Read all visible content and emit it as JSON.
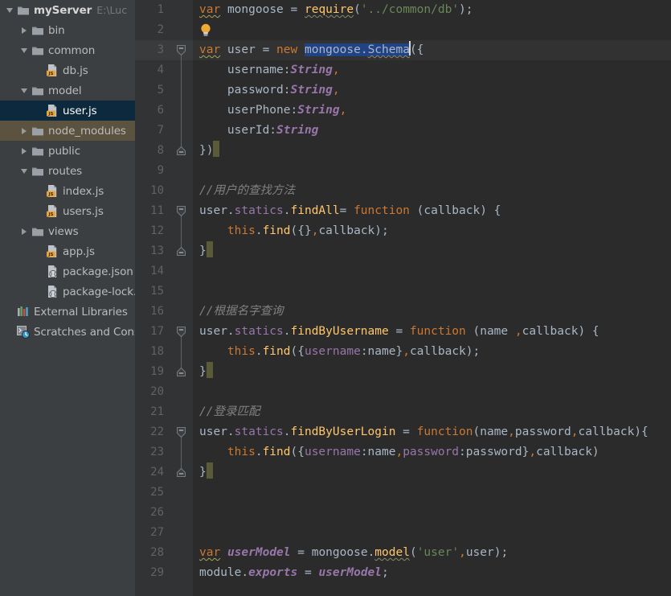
{
  "window": {
    "theme": "darcula",
    "accent_selection": "#214283",
    "sidebar_bg": "#3c3f41",
    "editor_bg": "#2b2b2b",
    "gutter_bg": "#313335",
    "current_line_bg": "#323232",
    "selected_row_bg": "#0d293e",
    "excluded_row_bg": "#5b5340"
  },
  "sidebar": {
    "items": [
      {
        "label": "myServer",
        "hint": "E:\\Luc",
        "indent": 0,
        "twisty": "expanded",
        "icon": "folder-icon",
        "bold": true,
        "state": "normal"
      },
      {
        "label": "bin",
        "hint": "",
        "indent": 1,
        "twisty": "collapsed",
        "icon": "folder-icon",
        "bold": false,
        "state": "normal"
      },
      {
        "label": "common",
        "hint": "",
        "indent": 1,
        "twisty": "expanded",
        "icon": "folder-icon",
        "bold": false,
        "state": "normal"
      },
      {
        "label": "db.js",
        "hint": "",
        "indent": 2,
        "twisty": "none",
        "icon": "js-file-icon",
        "bold": false,
        "state": "normal"
      },
      {
        "label": "model",
        "hint": "",
        "indent": 1,
        "twisty": "expanded",
        "icon": "folder-icon",
        "bold": false,
        "state": "normal"
      },
      {
        "label": "user.js",
        "hint": "",
        "indent": 2,
        "twisty": "none",
        "icon": "js-file-icon",
        "bold": false,
        "state": "selected"
      },
      {
        "label": "node_modules",
        "hint": "",
        "indent": 1,
        "twisty": "collapsed",
        "icon": "folder-icon",
        "bold": false,
        "state": "excluded"
      },
      {
        "label": "public",
        "hint": "",
        "indent": 1,
        "twisty": "collapsed",
        "icon": "folder-icon",
        "bold": false,
        "state": "normal"
      },
      {
        "label": "routes",
        "hint": "",
        "indent": 1,
        "twisty": "expanded",
        "icon": "folder-icon",
        "bold": false,
        "state": "normal"
      },
      {
        "label": "index.js",
        "hint": "",
        "indent": 2,
        "twisty": "none",
        "icon": "js-file-icon",
        "bold": false,
        "state": "normal"
      },
      {
        "label": "users.js",
        "hint": "",
        "indent": 2,
        "twisty": "none",
        "icon": "js-file-icon",
        "bold": false,
        "state": "normal"
      },
      {
        "label": "views",
        "hint": "",
        "indent": 1,
        "twisty": "collapsed",
        "icon": "folder-icon",
        "bold": false,
        "state": "normal"
      },
      {
        "label": "app.js",
        "hint": "",
        "indent": 2,
        "twisty": "none",
        "icon": "js-file-icon",
        "bold": false,
        "state": "normal"
      },
      {
        "label": "package.json",
        "hint": "",
        "indent": 2,
        "twisty": "none",
        "icon": "json-file-icon",
        "bold": false,
        "state": "normal"
      },
      {
        "label": "package-lock.json",
        "hint": "",
        "indent": 2,
        "twisty": "none",
        "icon": "json-file-icon",
        "bold": false,
        "state": "normal"
      },
      {
        "label": "External Libraries",
        "hint": "",
        "indent": 0,
        "twisty": "none",
        "icon": "libraries-icon",
        "bold": false,
        "state": "normal"
      },
      {
        "label": "Scratches and Consoles",
        "hint": "",
        "indent": 0,
        "twisty": "none",
        "icon": "scratches-icon",
        "bold": false,
        "state": "normal"
      }
    ]
  },
  "editor": {
    "filename": "user.js",
    "language": "JavaScript",
    "current_line": 3,
    "selection_text": "mongoose.Schema",
    "line_numbers": [
      1,
      2,
      3,
      4,
      5,
      6,
      7,
      8,
      9,
      10,
      11,
      12,
      13,
      14,
      15,
      16,
      17,
      18,
      19,
      20,
      21,
      22,
      23,
      24,
      25,
      26,
      27,
      28,
      29
    ],
    "lines": [
      {
        "n": 1,
        "text": "var mongoose = require('../common/db');"
      },
      {
        "n": 2,
        "text": ""
      },
      {
        "n": 3,
        "text": "var user = new mongoose.Schema({"
      },
      {
        "n": 4,
        "text": "    username:String,"
      },
      {
        "n": 5,
        "text": "    password:String,"
      },
      {
        "n": 6,
        "text": "    userPhone:String,"
      },
      {
        "n": 7,
        "text": "    userId:String"
      },
      {
        "n": 8,
        "text": "})"
      },
      {
        "n": 9,
        "text": ""
      },
      {
        "n": 10,
        "text": "//用户的查找方法"
      },
      {
        "n": 11,
        "text": "user.statics.findAll= function (callback) {"
      },
      {
        "n": 12,
        "text": "    this.find({},callback);"
      },
      {
        "n": 13,
        "text": "}"
      },
      {
        "n": 14,
        "text": ""
      },
      {
        "n": 15,
        "text": ""
      },
      {
        "n": 16,
        "text": "//根据名字查询"
      },
      {
        "n": 17,
        "text": "user.statics.findByUsername = function (name ,callback) {"
      },
      {
        "n": 18,
        "text": "    this.find({username:name},callback);"
      },
      {
        "n": 19,
        "text": "}"
      },
      {
        "n": 20,
        "text": ""
      },
      {
        "n": 21,
        "text": "//登录匹配"
      },
      {
        "n": 22,
        "text": "user.statics.findByUserLogin = function(name,password,callback){"
      },
      {
        "n": 23,
        "text": "    this.find({username:name,password:password},callback)"
      },
      {
        "n": 24,
        "text": "}"
      },
      {
        "n": 25,
        "text": ""
      },
      {
        "n": 26,
        "text": ""
      },
      {
        "n": 27,
        "text": ""
      },
      {
        "n": 28,
        "text": "var userModel = mongoose.model('user',user);"
      },
      {
        "n": 29,
        "text": "module.exports = userModel;"
      }
    ],
    "tokens": {
      "l1": [
        "var",
        " ",
        "mongoose",
        " = ",
        "require",
        "(",
        "'../common/db'",
        ");"
      ],
      "l3": [
        "var",
        " user = ",
        "new",
        " ",
        "mongoose.Schema",
        "({"
      ],
      "l10_comment": "//用户的查找方法",
      "l16_comment": "//根据名字查询",
      "l21_comment": "//登录匹配"
    },
    "gutter": {
      "intention_bulb_line": 2,
      "fold_regions": [
        {
          "start": 3,
          "end": 8
        },
        {
          "start": 11,
          "end": 13
        },
        {
          "start": 17,
          "end": 19
        },
        {
          "start": 22,
          "end": 24
        }
      ]
    },
    "syntax_colors": {
      "keyword": "#cc7832",
      "string": "#6a8759",
      "function": "#ffc66d",
      "property": "#9876aa",
      "comment": "#808080",
      "punctuation": "#a9b7c6",
      "number": "#6897bb"
    }
  }
}
